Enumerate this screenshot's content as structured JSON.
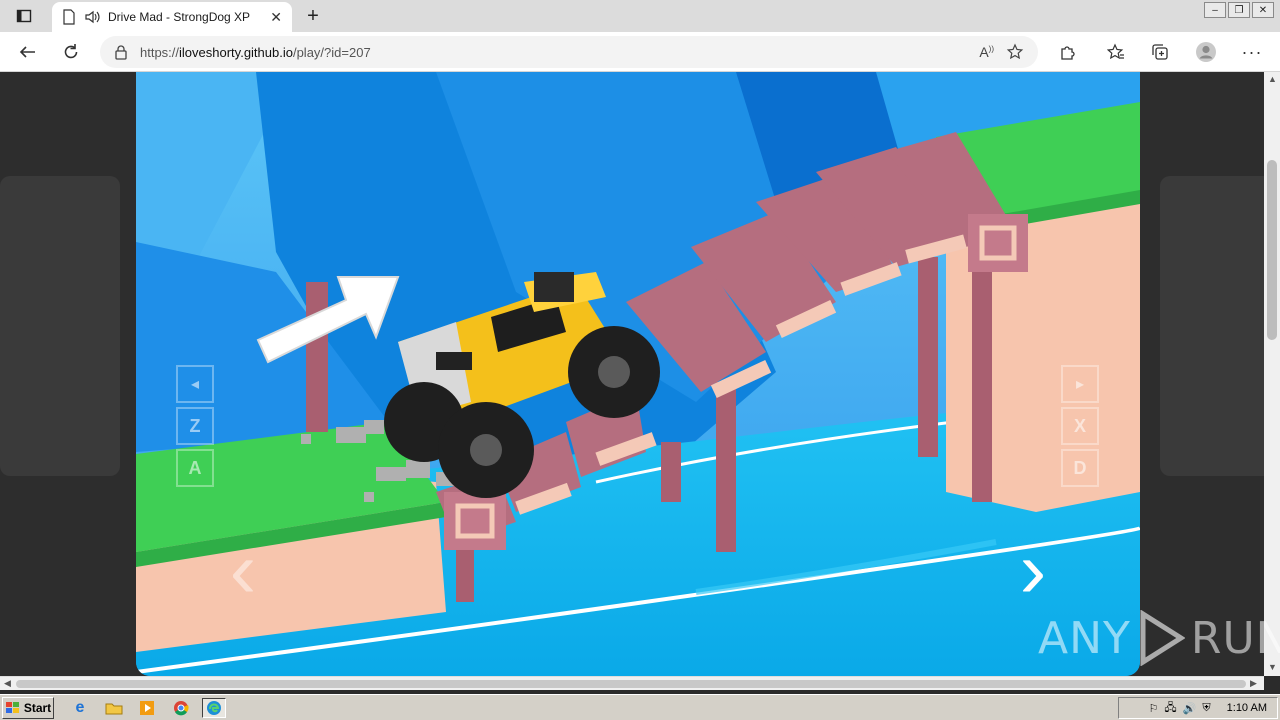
{
  "browser": {
    "tab": {
      "title": "Drive Mad - StrongDog XP",
      "icon": "page-icon",
      "audio_icon": "speaker-icon"
    },
    "url": {
      "prefix": "https://",
      "domain": "iloveshorty.github.io",
      "path": "/play/?id=207"
    },
    "window_controls": [
      "minimize",
      "restore",
      "close"
    ]
  },
  "game": {
    "name": "Drive Mad",
    "left_controls": [
      "◂",
      "Z",
      "A"
    ],
    "right_controls": [
      "▸",
      "X",
      "D"
    ],
    "prev_arrow": "‹",
    "next_arrow": "›",
    "colors": {
      "sky": "#3aa7f0",
      "water": "#17b6ef",
      "grass": "#3fcf55",
      "bridge": "#b06a7a",
      "truck": "#f4c01b"
    }
  },
  "watermark": {
    "text_left": "ANY",
    "text_right": "RUN"
  },
  "taskbar": {
    "start_label": "Start",
    "apps": [
      "ie-icon",
      "folder-icon",
      "media-player-icon",
      "chrome-icon",
      "edge-icon"
    ],
    "clock": "1:10 AM"
  }
}
